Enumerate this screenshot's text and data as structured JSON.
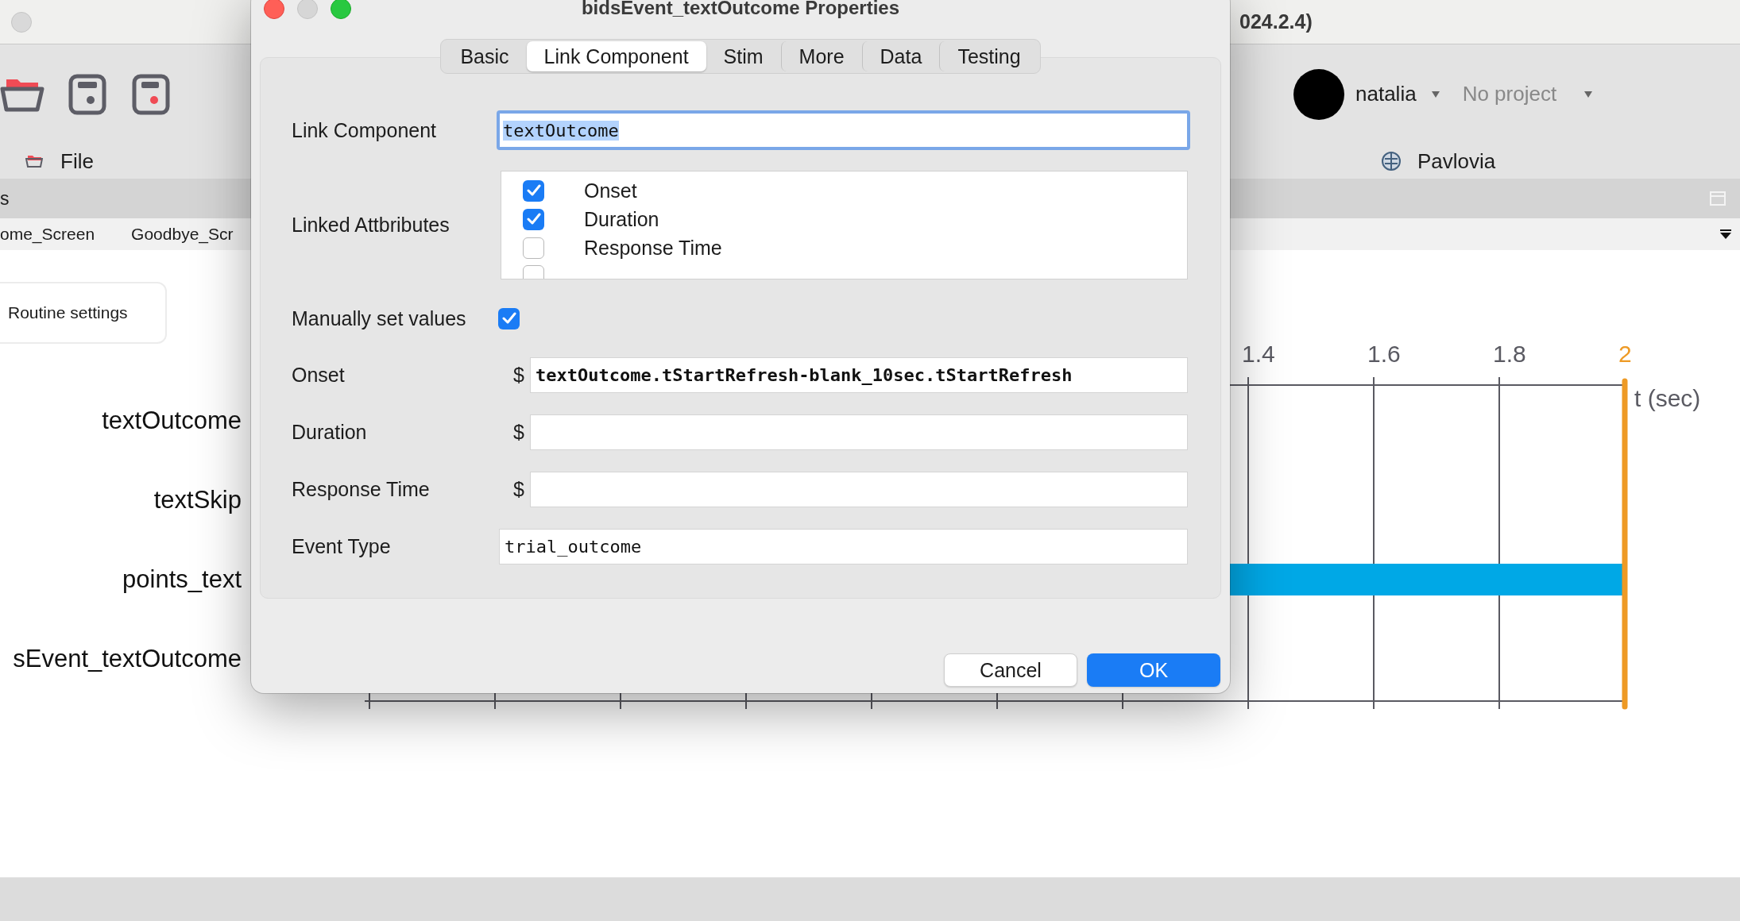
{
  "window": {
    "title": "024.2.4)"
  },
  "toolbar": {
    "file_label": "File",
    "user": "natalia",
    "project": "No project",
    "pavlovia_label": "Pavlovia"
  },
  "panel_header": {
    "title": "s"
  },
  "routine_tabs": [
    {
      "label": "ome_Screen"
    },
    {
      "label": "Goodbye_Scr"
    }
  ],
  "routine": {
    "settings_button": "Routine settings",
    "components": [
      {
        "name": "textOutcome",
        "has_bar": false
      },
      {
        "name": "textSkip",
        "has_bar": false
      },
      {
        "name": "points_text",
        "has_bar": true
      },
      {
        "name": "sEvent_textOutcome",
        "has_bar": false
      }
    ],
    "timeline": {
      "ticks": [
        "1.4",
        "1.6",
        "1.8"
      ],
      "end_label": "2",
      "axis_label": "t (sec)"
    }
  },
  "dialog": {
    "title": "bidsEvent_textOutcome Properties",
    "tabs": [
      {
        "label": "Basic",
        "selected": false
      },
      {
        "label": "Link Component",
        "selected": true
      },
      {
        "label": "Stim",
        "selected": false
      },
      {
        "label": "More",
        "selected": false
      },
      {
        "label": "Data",
        "selected": false
      },
      {
        "label": "Testing",
        "selected": false
      }
    ],
    "link_component": {
      "label": "Link Component",
      "value": "textOutcome"
    },
    "linked_attributes": {
      "label": "Linked Attbributes",
      "items": [
        {
          "label": "Onset",
          "checked": true
        },
        {
          "label": "Duration",
          "checked": true
        },
        {
          "label": "Response Time",
          "checked": false
        },
        {
          "checked": false
        }
      ]
    },
    "manual": {
      "label": "Manually set values",
      "checked": true
    },
    "value_fields": [
      {
        "label": "Onset",
        "prefix": "$",
        "value": "textOutcome.tStartRefresh-blank_10sec.tStartRefresh"
      },
      {
        "label": "Duration",
        "prefix": "$"
      },
      {
        "label": "Response Time",
        "prefix": "$"
      }
    ],
    "event_type": {
      "label": "Event Type",
      "value": "trial_outcome"
    },
    "buttons": [
      {
        "label": "Cancel",
        "kind": "secondary"
      },
      {
        "label": "OK",
        "kind": "primary"
      }
    ]
  }
}
